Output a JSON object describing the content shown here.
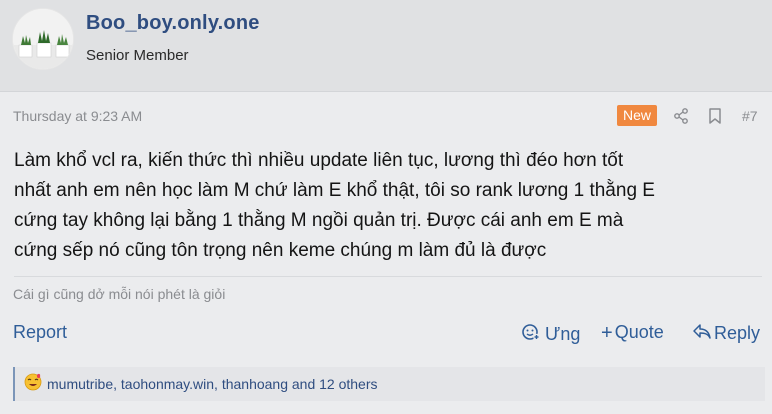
{
  "user": {
    "name": "Boo_boy.only.one",
    "title": "Senior Member"
  },
  "meta": {
    "date": "Thursday at 9:23 AM",
    "badge": "New",
    "post_number": "#7"
  },
  "post": {
    "lines": [
      "Làm khổ vcl ra, kiến thức thì nhiều update liên tục, lương thì đéo hơn tốt",
      "nhất anh em nên học làm M chứ làm E khổ thật, tôi so rank lương 1 thằng E",
      "cứng tay không lại bằng 1 thằng M ngồi quản trị. Được cái anh em E mà",
      "cứng sếp nó cũng tôn trọng nên keme chúng m làm đủ là được"
    ],
    "signature": "Cái gì cũng dở mỗi nói phét là giỏi"
  },
  "actions": {
    "report": "Report",
    "react": "Ưng",
    "quote": "Quote",
    "reply": "Reply"
  },
  "reactions": {
    "summary": "mumutribe, taohonmay.win, thanhoang and 12 others"
  },
  "colors": {
    "link": "#2f5d98",
    "username": "#2f4d80",
    "badge": "#f0883f",
    "muted": "#8a8c90"
  },
  "icons": [
    "share-icon",
    "bookmark-icon",
    "react-icon",
    "quote-plus-icon",
    "reply-icon",
    "reaction-emoji-icon"
  ]
}
